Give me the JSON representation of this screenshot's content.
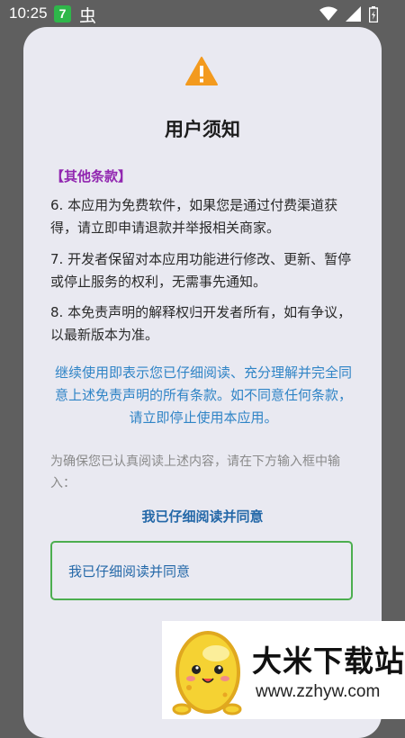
{
  "status_bar": {
    "time": "10:25",
    "app_badge": "7",
    "bug_glyph": "虫"
  },
  "dialog": {
    "title": "用户须知",
    "section_title": "【其他条款】",
    "clauses": [
      "6. 本应用为免费软件，如果您是通过付费渠道获得，请立即申请退款并举报相关商家。",
      "7. 开发者保留对本应用功能进行修改、更新、暂停或停止服务的权利，无需事先通知。",
      "8. 本免责声明的解释权归开发者所有，如有争议，以最新版本为准。"
    ],
    "notice": "继续使用即表示您已仔细阅读、充分理解并完全同意上述免责声明的所有条款。如不同意任何条款，请立即停止使用本应用。",
    "instruction": "为确保您已认真阅读上述内容，请在下方输入框中输入：",
    "phrase": "我已仔细阅读并同意",
    "input_value": "我已仔细阅读并同意"
  },
  "watermark": {
    "name": "大米下载站",
    "url": "www.zzhyw.com"
  },
  "colors": {
    "accent_purple": "#9126b0",
    "accent_blue": "#2f84c6",
    "input_border": "#4cae4f",
    "warning": "#f39a1e"
  },
  "icons": [
    "warning-icon",
    "wifi-icon",
    "signal-icon",
    "battery-icon",
    "bug-icon"
  ]
}
